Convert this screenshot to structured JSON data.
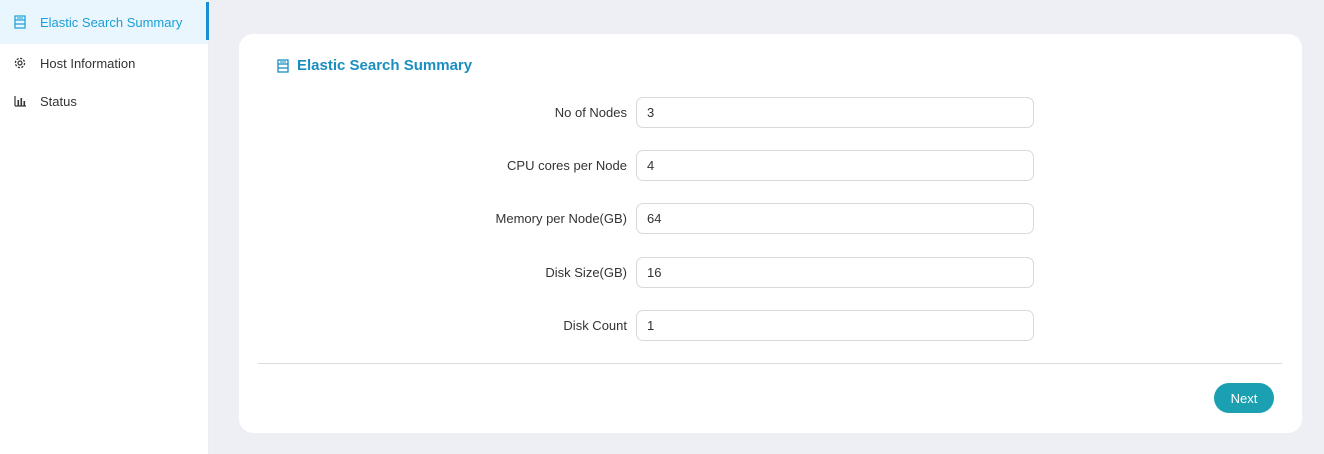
{
  "sidebar": {
    "items": [
      {
        "label": "Elastic Search Summary",
        "icon": "summary-icon",
        "active": true
      },
      {
        "label": "Host Information",
        "icon": "gear-icon",
        "active": false
      },
      {
        "label": "Status",
        "icon": "bar-chart-icon",
        "active": false
      }
    ]
  },
  "card": {
    "title": "Elastic Search Summary",
    "fields": [
      {
        "label": "No of Nodes",
        "value": "3"
      },
      {
        "label": "CPU cores per Node",
        "value": "4"
      },
      {
        "label": "Memory per Node(GB)",
        "value": "64"
      },
      {
        "label": "Disk Size(GB)",
        "value": "16"
      },
      {
        "label": "Disk Count",
        "value": "1"
      }
    ],
    "next_label": "Next"
  },
  "colors": {
    "accent": "#1a8fbf",
    "button": "#1ba0b2",
    "background": "#eeeef5"
  }
}
